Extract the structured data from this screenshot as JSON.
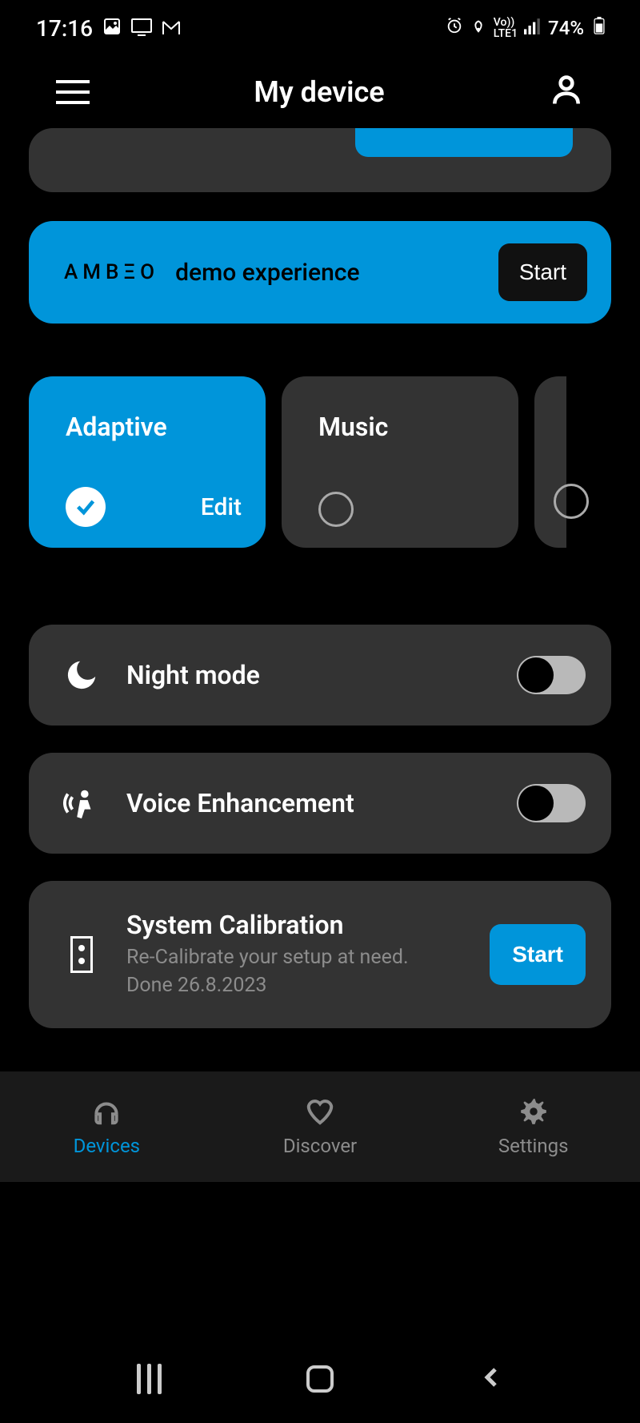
{
  "status": {
    "time": "17:16",
    "battery": "74%"
  },
  "header": {
    "title": "My device"
  },
  "demo": {
    "brand": "AMBΞO",
    "text": "demo experience",
    "button": "Start"
  },
  "presets": [
    {
      "title": "Adaptive",
      "edit": "Edit",
      "active": true
    },
    {
      "title": "Music",
      "active": false
    }
  ],
  "settings": {
    "night_mode": {
      "label": "Night mode",
      "on": false
    },
    "voice_enh": {
      "label": "Voice Enhancement",
      "on": false
    }
  },
  "calibration": {
    "title": "System Calibration",
    "sub1": "Re-Calibrate your setup at need.",
    "sub2": "Done 26.8.2023",
    "button": "Start"
  },
  "tabs": {
    "devices": "Devices",
    "discover": "Discover",
    "settings": "Settings"
  }
}
